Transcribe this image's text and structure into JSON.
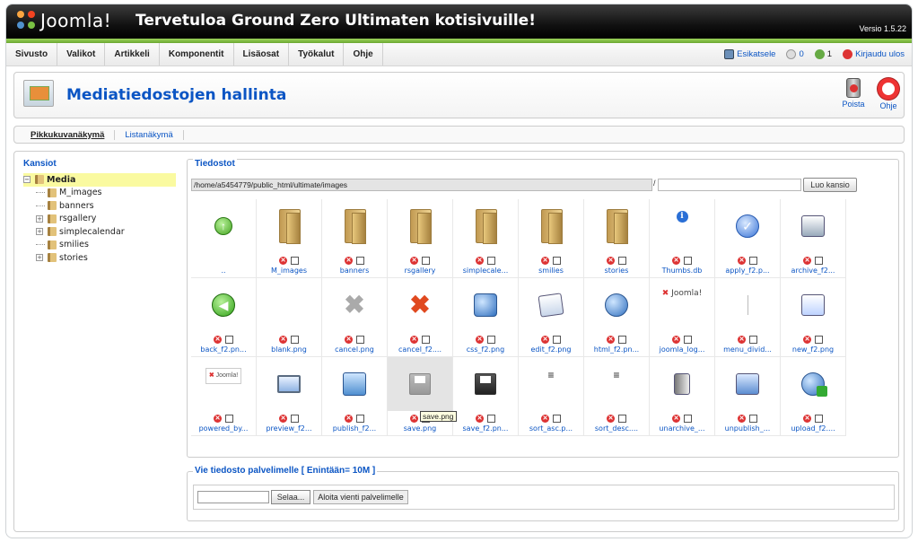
{
  "header": {
    "logo_text": "Joomla!",
    "site_title": "Tervetuloa Ground Zero Ultimaten kotisivuille!",
    "version": "Versio 1.5.22"
  },
  "menu": [
    "Sivusto",
    "Valikot",
    "Artikkeli",
    "Komponentit",
    "Lisäosat",
    "Työkalut",
    "Ohje"
  ],
  "status": {
    "preview_label": "Esikatsele",
    "messages_count": "0",
    "users_count": "1",
    "logout_label": "Kirjaudu ulos"
  },
  "toolbar": {
    "title": "Mediatiedostojen hallinta",
    "delete_label": "Poista",
    "help_label": "Ohje"
  },
  "views": {
    "thumbnail": "Pikkukuvanäkymä",
    "list": "Listanäkymä"
  },
  "folders": {
    "legend": "Kansiot",
    "root": "Media",
    "items": [
      {
        "label": "M_images",
        "expandable": false
      },
      {
        "label": "banners",
        "expandable": false
      },
      {
        "label": "rsgallery",
        "expandable": true
      },
      {
        "label": "simplecalendar",
        "expandable": true
      },
      {
        "label": "smilies",
        "expandable": false
      },
      {
        "label": "stories",
        "expandable": true
      }
    ]
  },
  "files": {
    "legend": "Tiedostot",
    "path": "/home/a5454779/public_html/ultimate/images",
    "separator": "/",
    "create_folder_label": "Luo kansio",
    "tooltip": "save.png",
    "items": [
      {
        "name": "..",
        "icon": "up-icon",
        "controls": false
      },
      {
        "name": "M_images",
        "icon": "folder-icon",
        "controls": true
      },
      {
        "name": "banners",
        "icon": "folder-icon",
        "controls": true
      },
      {
        "name": "rsgallery",
        "icon": "folder-icon",
        "controls": true
      },
      {
        "name": "simplecale...",
        "icon": "folder-icon",
        "controls": true
      },
      {
        "name": "smilies",
        "icon": "folder-icon",
        "controls": true
      },
      {
        "name": "stories",
        "icon": "folder-icon",
        "controls": true
      },
      {
        "name": "Thumbs.db",
        "icon": "info-icon",
        "controls": true
      },
      {
        "name": "apply_f2.p...",
        "icon": "apply-icon",
        "controls": true
      },
      {
        "name": "archive_f2...",
        "icon": "archive-icon",
        "controls": true
      },
      {
        "name": "back_f2.pn...",
        "icon": "back-icon",
        "controls": true
      },
      {
        "name": "blank.png",
        "icon": "blank-icon",
        "controls": true
      },
      {
        "name": "cancel.png",
        "icon": "cancel-gray-icon",
        "controls": true
      },
      {
        "name": "cancel_f2....",
        "icon": "cancel-red-icon",
        "controls": true
      },
      {
        "name": "css_f2.png",
        "icon": "css-icon",
        "controls": true
      },
      {
        "name": "edit_f2.png",
        "icon": "edit-icon",
        "controls": true
      },
      {
        "name": "html_f2.pn...",
        "icon": "html-icon",
        "controls": true
      },
      {
        "name": "joomla_log...",
        "icon": "joomla-logo-icon",
        "controls": true
      },
      {
        "name": "menu_divid...",
        "icon": "divider-icon",
        "controls": true
      },
      {
        "name": "new_f2.png",
        "icon": "new-icon",
        "controls": true
      },
      {
        "name": "powered_by...",
        "icon": "powered-by-icon",
        "controls": true
      },
      {
        "name": "preview_f2...",
        "icon": "preview-icon",
        "controls": true
      },
      {
        "name": "publish_f2...",
        "icon": "publish-icon",
        "controls": true
      },
      {
        "name": "save.png",
        "icon": "save-gray-icon",
        "controls": true
      },
      {
        "name": "save_f2.pn...",
        "icon": "save-icon",
        "controls": true
      },
      {
        "name": "sort_asc.p...",
        "icon": "sort-asc-icon",
        "controls": true
      },
      {
        "name": "sort_desc....",
        "icon": "sort-desc-icon",
        "controls": true
      },
      {
        "name": "unarchive_...",
        "icon": "unarchive-icon",
        "controls": true
      },
      {
        "name": "unpublish_...",
        "icon": "unpublish-icon",
        "controls": true
      },
      {
        "name": "upload_f2....",
        "icon": "upload-icon",
        "controls": true
      }
    ]
  },
  "upload": {
    "legend": "Vie tiedosto palvelimelle [ Enintään= 10M ]",
    "browse_label": "Selaa...",
    "start_label": "Aloita vienti palvelimelle"
  },
  "colors": {
    "link": "#0b55c4",
    "header_bg": "#111111",
    "accent_green": "#7cbf3f"
  }
}
